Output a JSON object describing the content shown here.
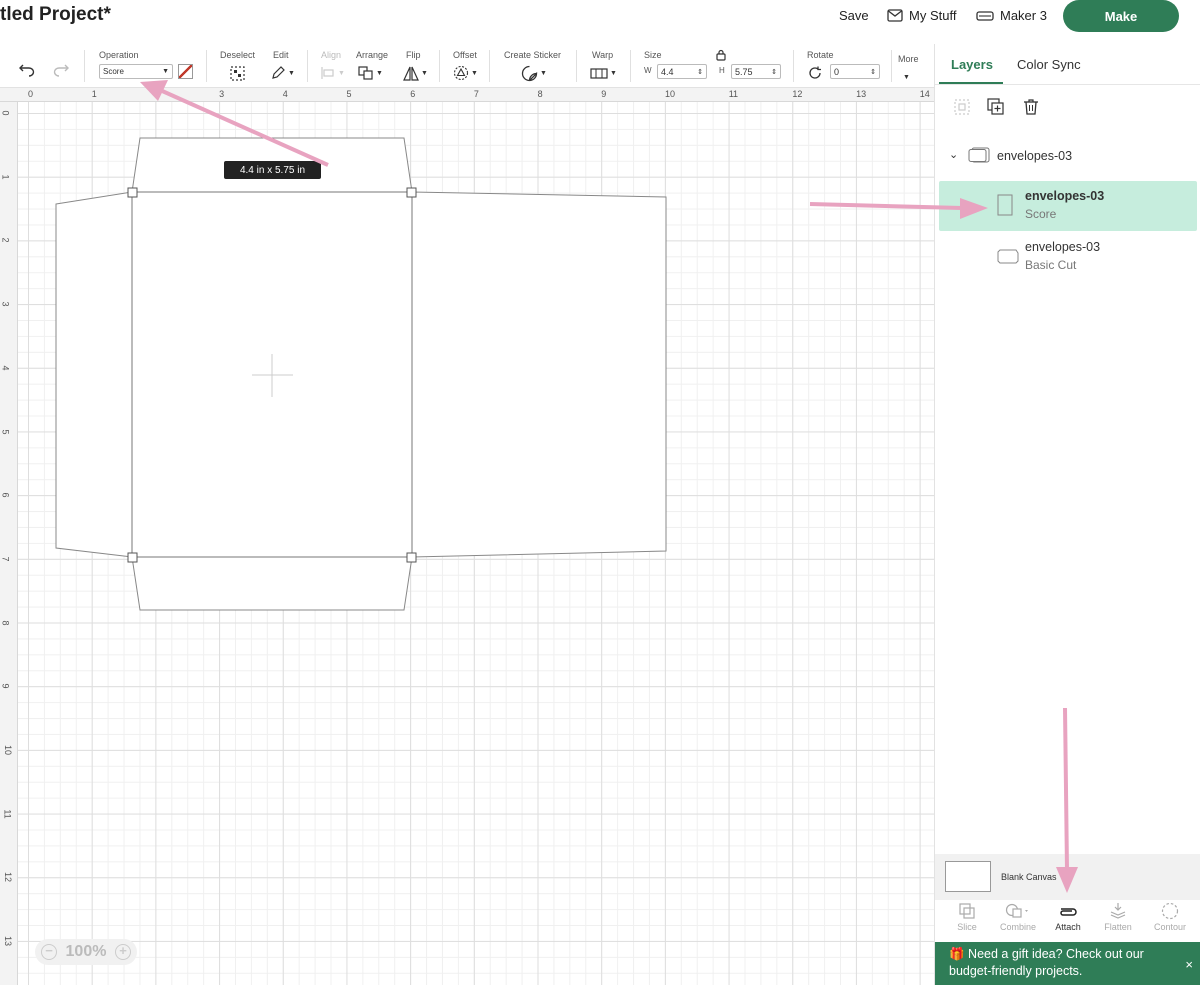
{
  "header": {
    "title": "tled Project*",
    "save_label": "Save",
    "my_stuff_label": "My Stuff",
    "machine_label": "Maker 3",
    "make_label": "Make"
  },
  "toolbar": {
    "operation_label": "Operation",
    "operation_value": "Score",
    "deselect_label": "Deselect",
    "edit_label": "Edit",
    "align_label": "Align",
    "arrange_label": "Arrange",
    "flip_label": "Flip",
    "offset_label": "Offset",
    "create_sticker_label": "Create Sticker",
    "warp_label": "Warp",
    "size_label": "Size",
    "width_letter": "W",
    "width_value": "4.4",
    "height_letter": "H",
    "height_value": "5.75",
    "rotate_label": "Rotate",
    "rotate_value": "0",
    "more_label": "More"
  },
  "canvas": {
    "ruler_x": [
      "0",
      "1",
      "2",
      "3",
      "4",
      "5",
      "6",
      "7",
      "8",
      "9",
      "10",
      "11",
      "12",
      "13",
      "14"
    ],
    "ruler_y": [
      "0",
      "1",
      "2",
      "3",
      "4",
      "5",
      "6",
      "7",
      "8",
      "9",
      "10",
      "11",
      "12",
      "13"
    ],
    "size_tooltip": "4.4  in x 5.75  in",
    "zoom_value": "100%"
  },
  "panel": {
    "tabs": [
      {
        "label": "Layers"
      },
      {
        "label": "Color Sync"
      }
    ],
    "group": {
      "name": "envelopes-03"
    },
    "layers": [
      {
        "name": "envelopes-03",
        "operation": "Score"
      },
      {
        "name": "envelopes-03",
        "operation": "Basic Cut"
      }
    ],
    "blank_canvas_label": "Blank Canvas",
    "tools": [
      {
        "label": "Slice"
      },
      {
        "label": "Combine"
      },
      {
        "label": "Attach"
      },
      {
        "label": "Flatten"
      },
      {
        "label": "Contour"
      }
    ],
    "promo_text": "🎁 Need a gift idea? Check out our budget-friendly projects.",
    "promo_close": "×"
  },
  "colors": {
    "accent_green": "#2f7d57",
    "selected_layer_bg": "#c6eddd",
    "annotation_pink": "#e8a3c0"
  }
}
